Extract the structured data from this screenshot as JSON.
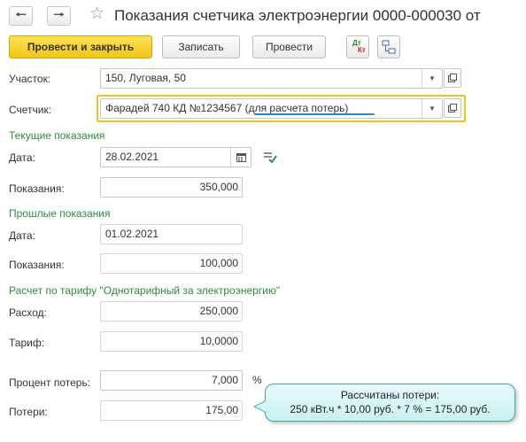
{
  "header": {
    "title": "Показания счетчика электроэнергии 0000-000030 от",
    "back_icon": "arrow-left-icon",
    "forward_icon": "arrow-right-icon",
    "favorite_icon": "star-icon"
  },
  "toolbar": {
    "post_and_close": "Провести и закрыть",
    "save": "Записать",
    "post": "Провести",
    "dt_label": "Дт",
    "kt_label": "Кт"
  },
  "fields": {
    "plot_label": "Участок:",
    "plot_value": "150, Луговая, 50",
    "meter_label": "Счетчик:",
    "meter_value": "Фарадей 740 КД №1234567 (для расчета потерь)"
  },
  "current": {
    "section": "Текущие показания",
    "date_label": "Дата:",
    "date_value": "28.02.2021",
    "reading_label": "Показания:",
    "reading_value": "350,000"
  },
  "previous": {
    "section": "Прошлые показания",
    "date_label": "Дата:",
    "date_value": "01.02.2021",
    "reading_label": "Показания:",
    "reading_value": "100,000"
  },
  "tariff": {
    "section": "Расчет по тарифу \"Однотарифный за электроэнергию\"",
    "consumption_label": "Расход:",
    "consumption_value": "250,000",
    "rate_label": "Тариф:",
    "rate_value": "10,0000",
    "loss_percent_label": "Процент потерь:",
    "loss_percent_value": "7,000",
    "percent_unit": "%",
    "losses_label": "Потери:",
    "losses_value": "175,00"
  },
  "tooltip": {
    "line1": "Рассчитаны потери:",
    "line2": "250 кВт.ч * 10,00 руб. * 7 % = 175,00 руб."
  },
  "colors": {
    "accent_yellow": "#f2c613",
    "section_green": "#2e8b3e",
    "focus_border": "#f0c419",
    "tooltip_border": "#3fa7a7",
    "underline_blue": "#1f8fd6"
  }
}
